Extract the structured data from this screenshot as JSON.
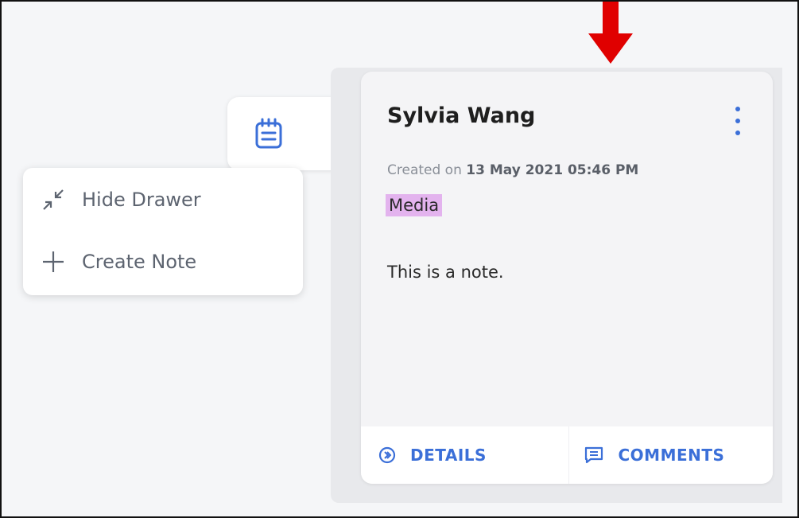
{
  "menu": {
    "items": [
      {
        "label": "Hide Drawer",
        "icon": "collapse-arrows-icon"
      },
      {
        "label": "Create Note",
        "icon": "plus-icon"
      }
    ]
  },
  "tab": {
    "icon": "notepad-icon"
  },
  "note": {
    "author": "Sylvia Wang",
    "created_prefix": "Created on",
    "created_date": "13 May 2021 05:46 PM",
    "tag": "Media",
    "body": "This is a note.",
    "actions": {
      "details_label": "DETAILS",
      "comments_label": "COMMENTS"
    }
  },
  "colors": {
    "accent": "#3b6fd8",
    "tag_bg": "#e3b3ee",
    "arrow": "#e00000"
  }
}
